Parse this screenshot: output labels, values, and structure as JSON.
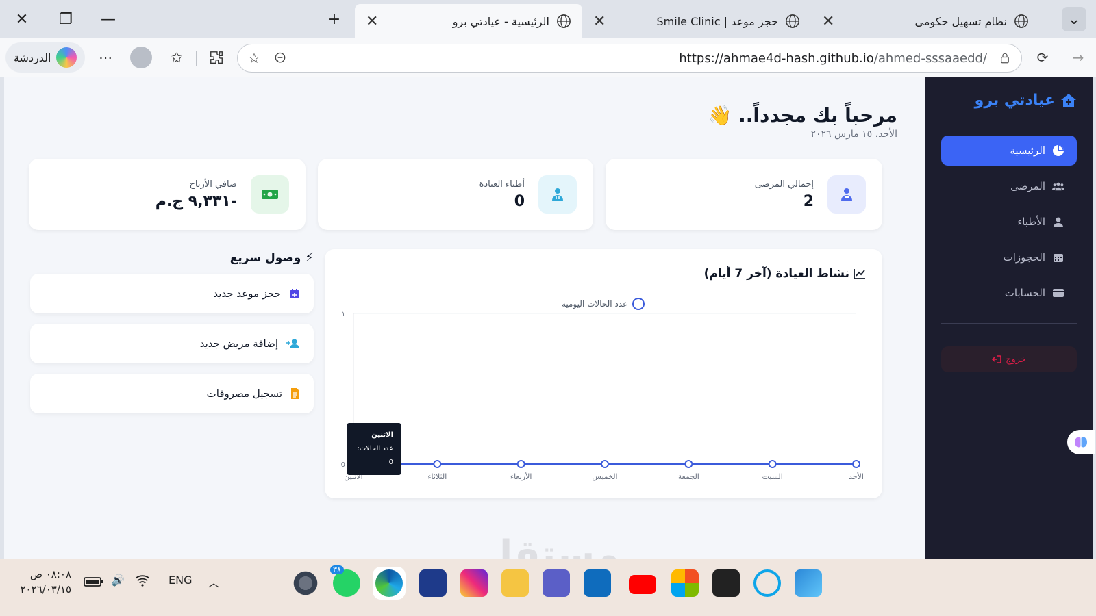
{
  "browser": {
    "tabs": [
      {
        "title": "الرئيسية - عيادتي برو",
        "active": true
      },
      {
        "title": "حجز موعد | Smile Clinic",
        "active": false
      },
      {
        "title": "نظام تسهيل حكومى",
        "active": false
      }
    ],
    "url_host": "https://ahmae4d-hash.github.io",
    "url_path": "/ahmed-sssaaedd/",
    "chat_label": "الدردشة"
  },
  "sidebar": {
    "brand": "عيادتي برو",
    "items": [
      {
        "label": "الرئيسية",
        "icon": "pie-chart-icon",
        "active": true
      },
      {
        "label": "المرضى",
        "icon": "users-icon",
        "active": false
      },
      {
        "label": "الأطباء",
        "icon": "doctor-icon",
        "active": false
      },
      {
        "label": "الحجوزات",
        "icon": "calendar-icon",
        "active": false
      },
      {
        "label": "الحسابات",
        "icon": "wallet-icon",
        "active": false
      }
    ],
    "logout": "خروج"
  },
  "header": {
    "welcome": "مرحباً بك مجدداً..",
    "wave": "👋",
    "date": "الأحد، ١٥ مارس ٢٠٢٦"
  },
  "stats": [
    {
      "label": "إجمالي المرضى",
      "value": "2",
      "icon": "patient-icon",
      "color": "#4f6bed"
    },
    {
      "label": "أطباء العيادة",
      "value": "0",
      "icon": "doctor-icon",
      "color": "#2ea8d8"
    },
    {
      "label": "صافي الأرباح",
      "value": "-٩,٣٣١ ج.م",
      "icon": "money-icon",
      "color": "#22a447"
    }
  ],
  "chart_section_title": "نشاط العيادة (آخر 7 أيام)",
  "quick_access": {
    "title": "وصول سريع",
    "items": [
      {
        "label": "حجز موعد جديد",
        "icon": "calendar-plus-icon",
        "color": "#4f46e5"
      },
      {
        "label": "إضافة مريض جديد",
        "icon": "user-plus-icon",
        "color": "#2ea8d8"
      },
      {
        "label": "تسجيل مصروفات",
        "icon": "receipt-icon",
        "color": "#f59e0b"
      }
    ]
  },
  "chart_data": {
    "type": "line",
    "categories": [
      "الاثنين",
      "الثلاثاء",
      "الأربعاء",
      "الخميس",
      "الجمعة",
      "السبت",
      "الأحد"
    ],
    "series": [
      {
        "name": "عدد الحالات اليومية",
        "values": [
          0,
          0,
          0,
          0,
          0,
          0,
          0
        ]
      }
    ],
    "ylim": [
      0,
      1
    ],
    "yticks": [
      "0",
      "١"
    ],
    "grid": true,
    "legend": "top",
    "color": "#3b5bdb",
    "tooltip": {
      "title": "الاثنين",
      "line": "عدد الحالات: 0"
    }
  },
  "taskbar": {
    "time": "٠٨:٠٨ ص",
    "date": "٢٠٢٦/٠٣/١٥",
    "lang": "ENG",
    "whatsapp_badge": "٣٨"
  },
  "watermark": "مستقل"
}
